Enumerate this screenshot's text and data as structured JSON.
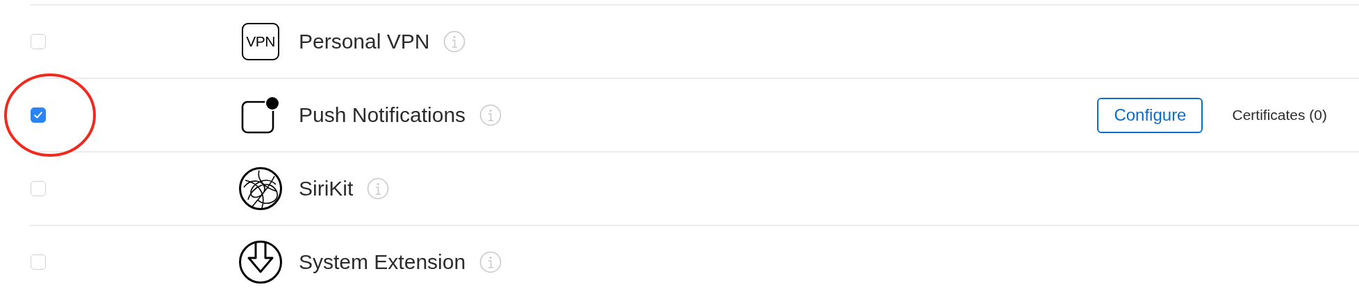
{
  "capabilities": [
    {
      "label": "Personal VPN",
      "checked": false,
      "circled": false,
      "icon": {
        "kind": "vpn",
        "text": "VPN"
      }
    },
    {
      "label": "Push Notifications",
      "checked": true,
      "circled": true,
      "icon": {
        "kind": "push"
      },
      "configure": "Configure",
      "certificates": "Certificates (0)"
    },
    {
      "label": "SiriKit",
      "checked": false,
      "circled": false,
      "icon": {
        "kind": "siri"
      }
    },
    {
      "label": "System Extension",
      "checked": false,
      "circled": false,
      "icon": {
        "kind": "extension"
      }
    }
  ]
}
